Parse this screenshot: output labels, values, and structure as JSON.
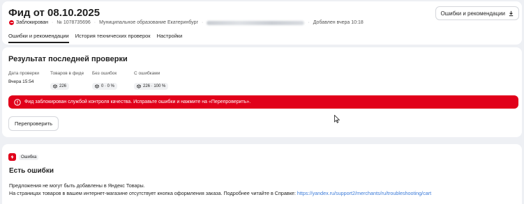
{
  "header": {
    "title": "Фид от 08.10.2025",
    "action_label": "Ошибки и рекомендации",
    "status": "Заблокирован",
    "feed_number": "№ 1078735696",
    "municipality": "Муниципальное образование Екатеринбург",
    "added": "Добавлен вчера 10:18",
    "tabs": [
      {
        "label": "Ошибки и рекомендации"
      },
      {
        "label": "История технических проверок"
      },
      {
        "label": "Настройки"
      }
    ]
  },
  "result": {
    "title": "Результат последней проверки",
    "stats": [
      {
        "label": "Дата проверки",
        "value": "Вчера 15:54"
      },
      {
        "label": "Товаров в фиде",
        "value": "226"
      },
      {
        "label": "Без ошибок",
        "value": "0 · 0 %"
      },
      {
        "label": "С ошибками",
        "value": "226 · 100 %"
      }
    ],
    "alert": "Фид заблокирован службой контроля качества. Исправьте ошибки и нажмите на «Перепроверить».",
    "recheck_label": "Перепроверить"
  },
  "error": {
    "tag": "Ошибка",
    "title": "Есть ошибки",
    "line1": "Предложения не могут быть добавлены в Яндекс Товары.",
    "line2_text": "На страницах товаров в вашем интернет-магазине отсутствует кнопка оформления заказа. Подробнее читайте в Справке: ",
    "link": "https://yandex.ru/support2/merchants/ru/troubleshooting/cart"
  },
  "colors": {
    "accent_red": "#e1001a",
    "link_blue": "#3b7bd9",
    "background": "#eef0f4"
  },
  "icons": [
    "download-icon",
    "blocked-status-icon",
    "cube-icon",
    "alert-circle-icon",
    "bolt-icon",
    "mouse-cursor-icon"
  ]
}
